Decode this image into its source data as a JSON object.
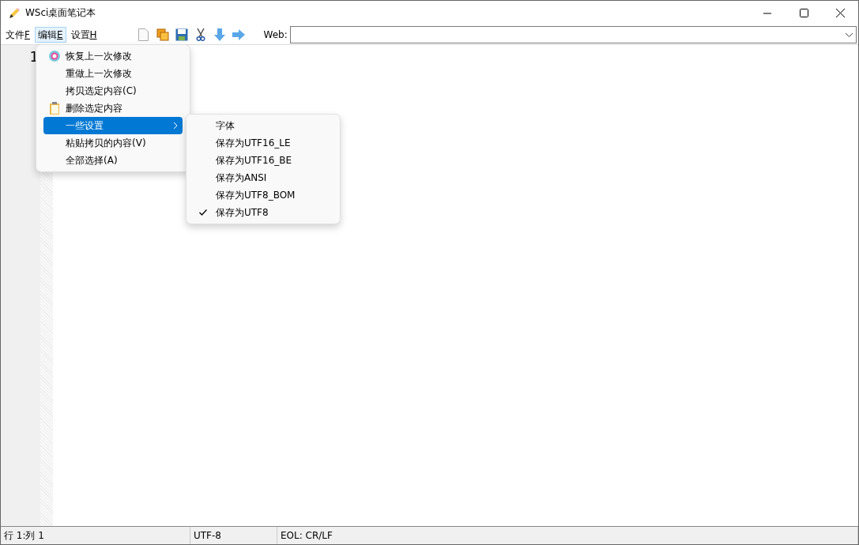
{
  "window": {
    "title": "WSci桌面笔记本"
  },
  "menubar": [
    {
      "label": "文件",
      "key": "F",
      "selected": false
    },
    {
      "label": "编辑",
      "key": "E",
      "selected": true
    },
    {
      "label": "设置",
      "key": "H",
      "selected": false
    }
  ],
  "web": {
    "label": "Web:"
  },
  "editor": {
    "line_numbers": [
      "1"
    ]
  },
  "edit_menu": [
    {
      "label": "恢复上一次修改",
      "kind": "refresh",
      "selected": false
    },
    {
      "label": "重做上一次修改",
      "kind": "plain",
      "selected": false
    },
    {
      "label": "拷贝选定内容(C)",
      "kind": "plain",
      "selected": false
    },
    {
      "label": "删除选定内容",
      "kind": "clipboard",
      "selected": false
    },
    {
      "label": "一些设置",
      "kind": "submenu",
      "selected": true
    },
    {
      "label": "粘贴拷贝的内容(V)",
      "kind": "plain",
      "selected": false
    },
    {
      "label": "全部选择(A)",
      "kind": "plain",
      "selected": false
    }
  ],
  "submenu": [
    {
      "label": "字体",
      "checked": false
    },
    {
      "label": "保存为UTF16_LE",
      "checked": false
    },
    {
      "label": "保存为UTF16_BE",
      "checked": false
    },
    {
      "label": "保存为ANSI",
      "checked": false
    },
    {
      "label": "保存为UTF8_BOM",
      "checked": false
    },
    {
      "label": "保存为UTF8",
      "checked": true
    }
  ],
  "status_bar": [
    "行 1:列 1",
    "UTF-8",
    "EOL: CR/LF"
  ]
}
